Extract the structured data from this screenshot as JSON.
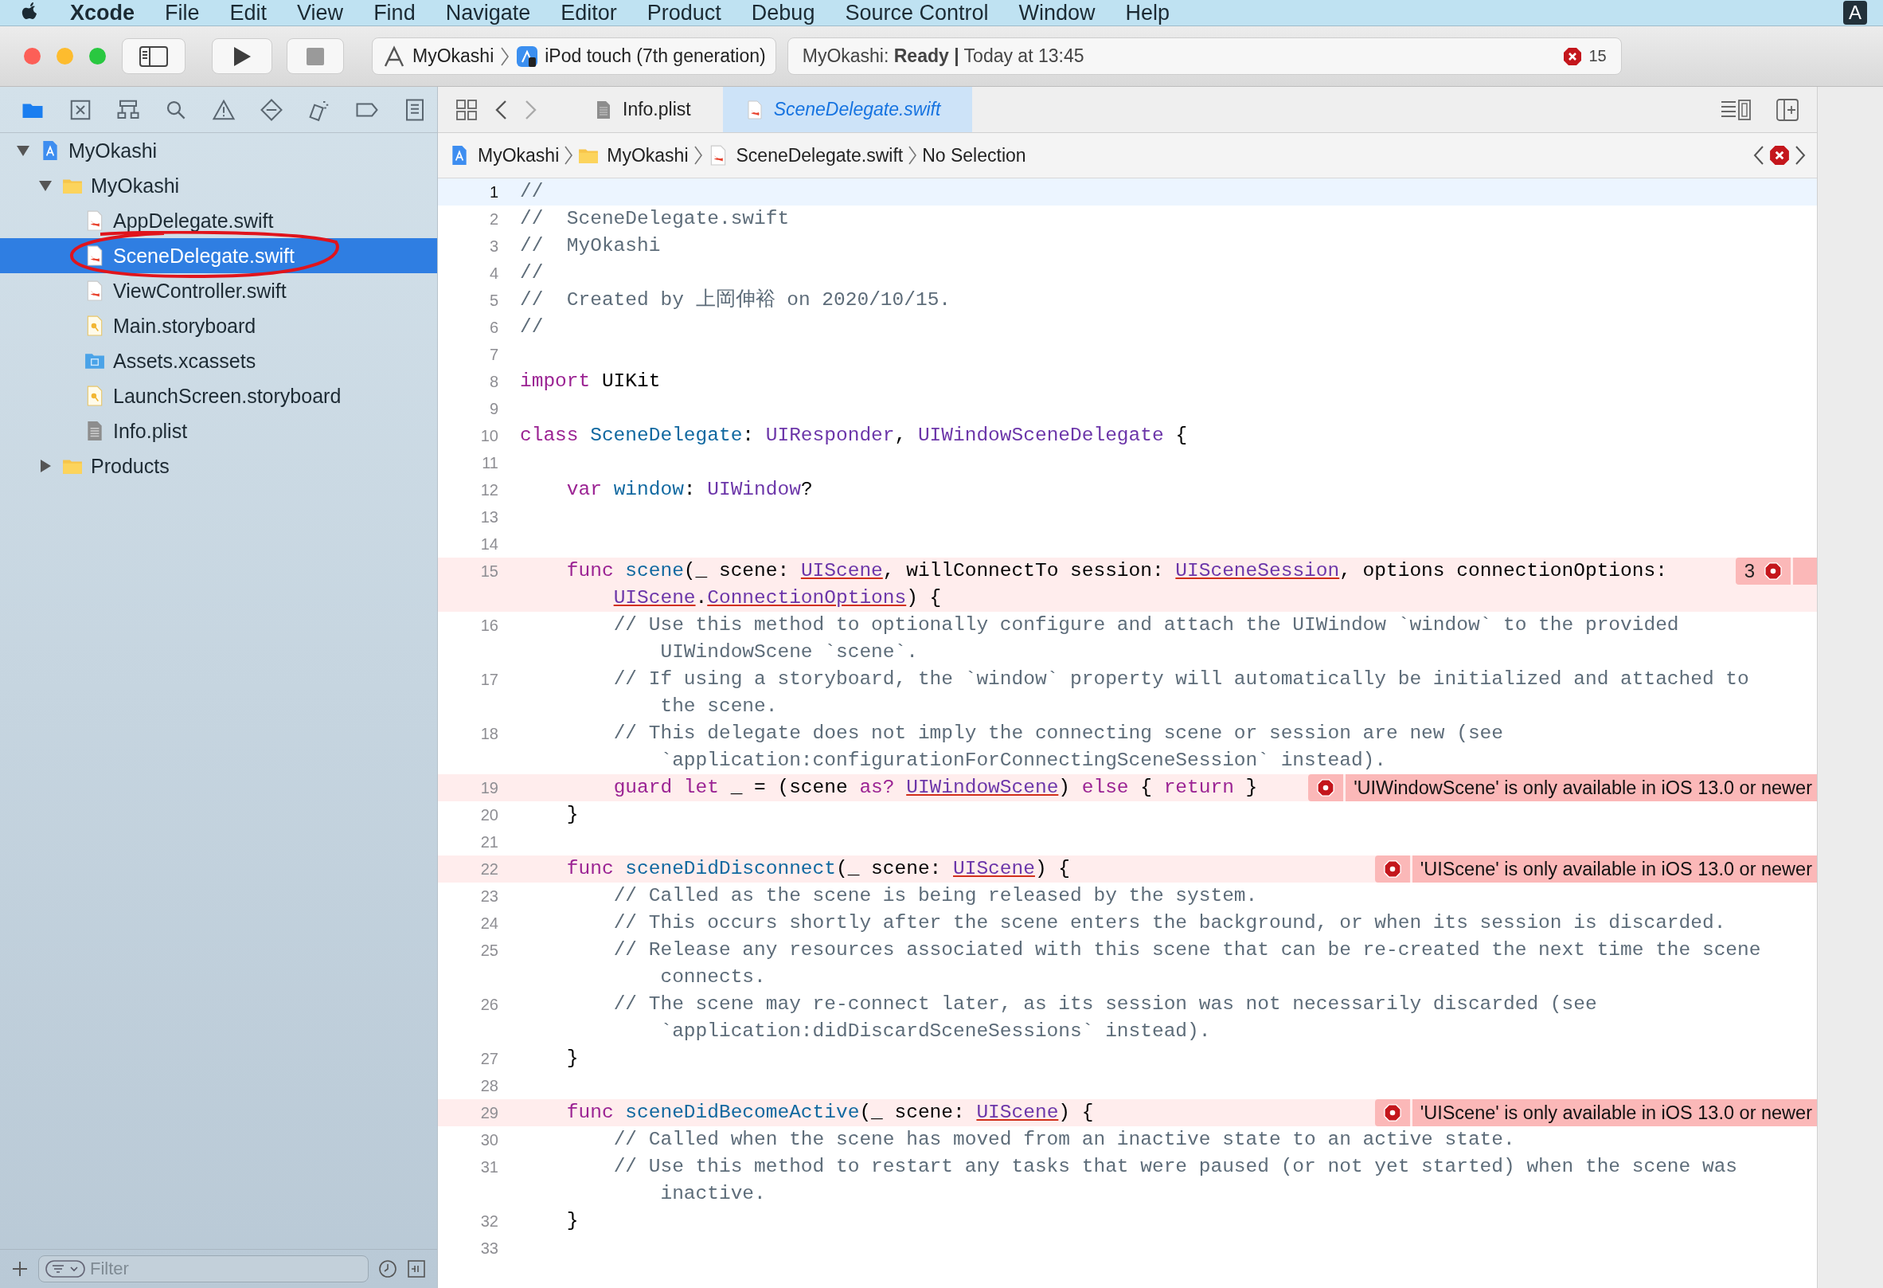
{
  "menu_bar": {
    "app": "Xcode",
    "items": [
      "File",
      "Edit",
      "View",
      "Find",
      "Navigate",
      "Editor",
      "Product",
      "Debug",
      "Source Control",
      "Window",
      "Help"
    ],
    "input_source": "A"
  },
  "toolbar": {
    "scheme": {
      "target": "MyOkashi",
      "device": "iPod touch (7th generation)"
    },
    "status": {
      "text": "MyOkashi: **Ready |** Today at 13:45",
      "error_count": "15"
    }
  },
  "navigator": {
    "tabs": [
      {
        "selected": true
      },
      {
        "selected": false
      },
      {
        "selected": false
      },
      {
        "selected": false
      },
      {
        "selected": false
      },
      {
        "selected": false
      },
      {
        "selected": false
      },
      {
        "selected": false
      },
      {
        "selected": false
      }
    ],
    "tree": [
      {
        "label": "MyOkashi",
        "kind": "project",
        "expanded": true,
        "selected": false,
        "children": [
          {
            "label": "MyOkashi",
            "kind": "group",
            "expanded": true,
            "selected": false,
            "children": [
              {
                "label": "AppDelegate.swift",
                "kind": "swift",
                "selected": false
              },
              {
                "label": "SceneDelegate.swift",
                "kind": "swift",
                "selected": true
              },
              {
                "label": "ViewController.swift",
                "kind": "swift",
                "selected": false
              },
              {
                "label": "Main.storyboard",
                "kind": "storyboard",
                "selected": false
              },
              {
                "label": "Assets.xcassets",
                "kind": "assets",
                "selected": false
              },
              {
                "label": "LaunchScreen.storyboard",
                "kind": "storyboard",
                "selected": false
              },
              {
                "label": "Info.plist",
                "kind": "plist",
                "selected": false
              }
            ]
          },
          {
            "label": "Products",
            "kind": "group",
            "expanded": false,
            "selected": false
          }
        ]
      }
    ],
    "filter": {
      "placeholder": "Filter"
    }
  },
  "editor": {
    "tabs": [
      {
        "label": "Info.plist",
        "kind": "plist",
        "selected": false
      },
      {
        "label": "SceneDelegate.swift",
        "kind": "swift",
        "selected": true
      }
    ],
    "breadcrumb": [
      {
        "label": "MyOkashi",
        "kind": "project"
      },
      {
        "label": "MyOkashi",
        "kind": "group"
      },
      {
        "label": "SceneDelegate.swift",
        "kind": "swift"
      },
      {
        "label": "No Selection",
        "kind": "none"
      }
    ],
    "lines": [
      {
        "n": "1",
        "current": true,
        "rows": [
          {
            "tokens": [
              {
                "kind": "c",
                "text": "//"
              }
            ]
          }
        ]
      },
      {
        "n": "2",
        "rows": [
          {
            "tokens": [
              {
                "kind": "c",
                "text": "//  SceneDelegate.swift"
              }
            ]
          }
        ]
      },
      {
        "n": "3",
        "rows": [
          {
            "tokens": [
              {
                "kind": "c",
                "text": "//  MyOkashi"
              }
            ]
          }
        ]
      },
      {
        "n": "4",
        "rows": [
          {
            "tokens": [
              {
                "kind": "c",
                "text": "//"
              }
            ]
          }
        ]
      },
      {
        "n": "5",
        "rows": [
          {
            "tokens": [
              {
                "kind": "c",
                "text": "//  Created by 上岡伸裕 on 2020/10/15."
              }
            ]
          }
        ]
      },
      {
        "n": "6",
        "rows": [
          {
            "tokens": [
              {
                "kind": "c",
                "text": "//"
              }
            ]
          }
        ]
      },
      {
        "n": "7"
      },
      {
        "n": "8",
        "rows": [
          {
            "tokens": [
              {
                "kind": "kw",
                "text": "import"
              },
              {
                "kind": "p",
                "text": " UIKit"
              }
            ]
          }
        ]
      },
      {
        "n": "9"
      },
      {
        "n": "10",
        "rows": [
          {
            "tokens": [
              {
                "kind": "kw",
                "text": "class"
              },
              {
                "kind": "decl",
                "text": " SceneDelegate"
              },
              {
                "kind": "p",
                "text": ": "
              },
              {
                "kind": "type",
                "text": "UIResponder"
              },
              {
                "kind": "p",
                "text": ", "
              },
              {
                "kind": "type",
                "text": "UIWindowSceneDelegate"
              },
              {
                "kind": "p",
                "text": " {"
              }
            ]
          }
        ]
      },
      {
        "n": "11"
      },
      {
        "n": "12",
        "rows": [
          {
            "tokens": [
              {
                "kind": "kw",
                "text": "    var"
              },
              {
                "kind": "decl",
                "text": " window"
              },
              {
                "kind": "p",
                "text": ": "
              },
              {
                "kind": "type",
                "text": "UIWindow"
              },
              {
                "kind": "p",
                "text": "?"
              }
            ]
          }
        ]
      },
      {
        "n": "13"
      },
      {
        "n": "14"
      },
      {
        "n": "15",
        "error": {
          "kind": "count",
          "text": "3"
        },
        "rows": [
          {
            "tokens": [
              {
                "kind": "kw",
                "text": "    func"
              },
              {
                "kind": "decl",
                "text": " scene"
              },
              {
                "kind": "p",
                "text": "(_ scene: "
              },
              {
                "kind": "etype",
                "text": "UIScene"
              },
              {
                "kind": "p",
                "text": ", willConnectTo session: "
              },
              {
                "kind": "etype",
                "text": "UISceneSession"
              },
              {
                "kind": "p",
                "text": ", options connectionOptions:"
              }
            ]
          },
          {
            "tokens": [
              {
                "kind": "etype",
                "text": "        UIScene"
              },
              {
                "kind": "p",
                "text": "."
              },
              {
                "kind": "etype",
                "text": "ConnectionOptions"
              },
              {
                "kind": "p",
                "text": ") {"
              }
            ]
          }
        ]
      },
      {
        "n": "16",
        "rows": [
          {
            "tokens": [
              {
                "kind": "c",
                "text": "        // Use this method to optionally configure and attach the UIWindow `window` to the provided"
              }
            ]
          },
          {
            "tokens": [
              {
                "kind": "c",
                "text": "            UIWindowScene `scene`."
              }
            ]
          }
        ]
      },
      {
        "n": "17",
        "rows": [
          {
            "tokens": [
              {
                "kind": "c",
                "text": "        // If using a storyboard, the `window` property will automatically be initialized and attached to"
              }
            ]
          },
          {
            "tokens": [
              {
                "kind": "c",
                "text": "            the scene."
              }
            ]
          }
        ]
      },
      {
        "n": "18",
        "rows": [
          {
            "tokens": [
              {
                "kind": "c",
                "text": "        // This delegate does not imply the connecting scene or session are new (see"
              }
            ]
          },
          {
            "tokens": [
              {
                "kind": "c",
                "text": "            `application:configurationForConnectingSceneSession` instead)."
              }
            ]
          }
        ]
      },
      {
        "n": "19",
        "error": {
          "kind": "message",
          "text": "'UIWindowScene' is only available in iOS 13.0 or newer"
        },
        "rows": [
          {
            "tokens": [
              {
                "kind": "kw",
                "text": "        guard let"
              },
              {
                "kind": "p",
                "text": " _ = (scene "
              },
              {
                "kind": "kw",
                "text": "as?"
              },
              {
                "kind": "etype",
                "text": " UIWindowScene"
              },
              {
                "kind": "p",
                "text": ") "
              },
              {
                "kind": "kw",
                "text": "else"
              },
              {
                "kind": "p",
                "text": " { "
              },
              {
                "kind": "kw",
                "text": "return"
              },
              {
                "kind": "p",
                "text": " }"
              }
            ]
          }
        ]
      },
      {
        "n": "20",
        "rows": [
          {
            "tokens": [
              {
                "kind": "p",
                "text": "    }"
              }
            ]
          }
        ]
      },
      {
        "n": "21"
      },
      {
        "n": "22",
        "error": {
          "kind": "message",
          "text": "'UIScene' is only available in iOS 13.0 or newer"
        },
        "rows": [
          {
            "tokens": [
              {
                "kind": "kw",
                "text": "    func"
              },
              {
                "kind": "decl",
                "text": " sceneDidDisconnect"
              },
              {
                "kind": "p",
                "text": "(_ scene: "
              },
              {
                "kind": "etype",
                "text": "UIScene"
              },
              {
                "kind": "p",
                "text": ") {"
              }
            ]
          }
        ]
      },
      {
        "n": "23",
        "rows": [
          {
            "tokens": [
              {
                "kind": "c",
                "text": "        // Called as the scene is being released by the system."
              }
            ]
          }
        ]
      },
      {
        "n": "24",
        "rows": [
          {
            "tokens": [
              {
                "kind": "c",
                "text": "        // This occurs shortly after the scene enters the background, or when its session is discarded."
              }
            ]
          }
        ]
      },
      {
        "n": "25",
        "rows": [
          {
            "tokens": [
              {
                "kind": "c",
                "text": "        // Release any resources associated with this scene that can be re-created the next time the scene"
              }
            ]
          },
          {
            "tokens": [
              {
                "kind": "c",
                "text": "            connects."
              }
            ]
          }
        ]
      },
      {
        "n": "26",
        "rows": [
          {
            "tokens": [
              {
                "kind": "c",
                "text": "        // The scene may re-connect later, as its session was not necessarily discarded (see"
              }
            ]
          },
          {
            "tokens": [
              {
                "kind": "c",
                "text": "            `application:didDiscardSceneSessions` instead)."
              }
            ]
          }
        ]
      },
      {
        "n": "27",
        "rows": [
          {
            "tokens": [
              {
                "kind": "p",
                "text": "    }"
              }
            ]
          }
        ]
      },
      {
        "n": "28"
      },
      {
        "n": "29",
        "error": {
          "kind": "message",
          "text": "'UIScene' is only available in iOS 13.0 or newer"
        },
        "rows": [
          {
            "tokens": [
              {
                "kind": "kw",
                "text": "    func"
              },
              {
                "kind": "decl",
                "text": " sceneDidBecomeActive"
              },
              {
                "kind": "p",
                "text": "(_ scene: "
              },
              {
                "kind": "etype",
                "text": "UIScene"
              },
              {
                "kind": "p",
                "text": ") {"
              }
            ]
          }
        ]
      },
      {
        "n": "30",
        "rows": [
          {
            "tokens": [
              {
                "kind": "c",
                "text": "        // Called when the scene has moved from an inactive state to an active state."
              }
            ]
          }
        ]
      },
      {
        "n": "31",
        "rows": [
          {
            "tokens": [
              {
                "kind": "c",
                "text": "        // Use this method to restart any tasks that were paused (or not yet started) when the scene was"
              }
            ]
          },
          {
            "tokens": [
              {
                "kind": "c",
                "text": "            inactive."
              }
            ]
          }
        ]
      },
      {
        "n": "32",
        "rows": [
          {
            "tokens": [
              {
                "kind": "p",
                "text": "    }"
              }
            ]
          }
        ]
      },
      {
        "n": "33"
      }
    ]
  }
}
